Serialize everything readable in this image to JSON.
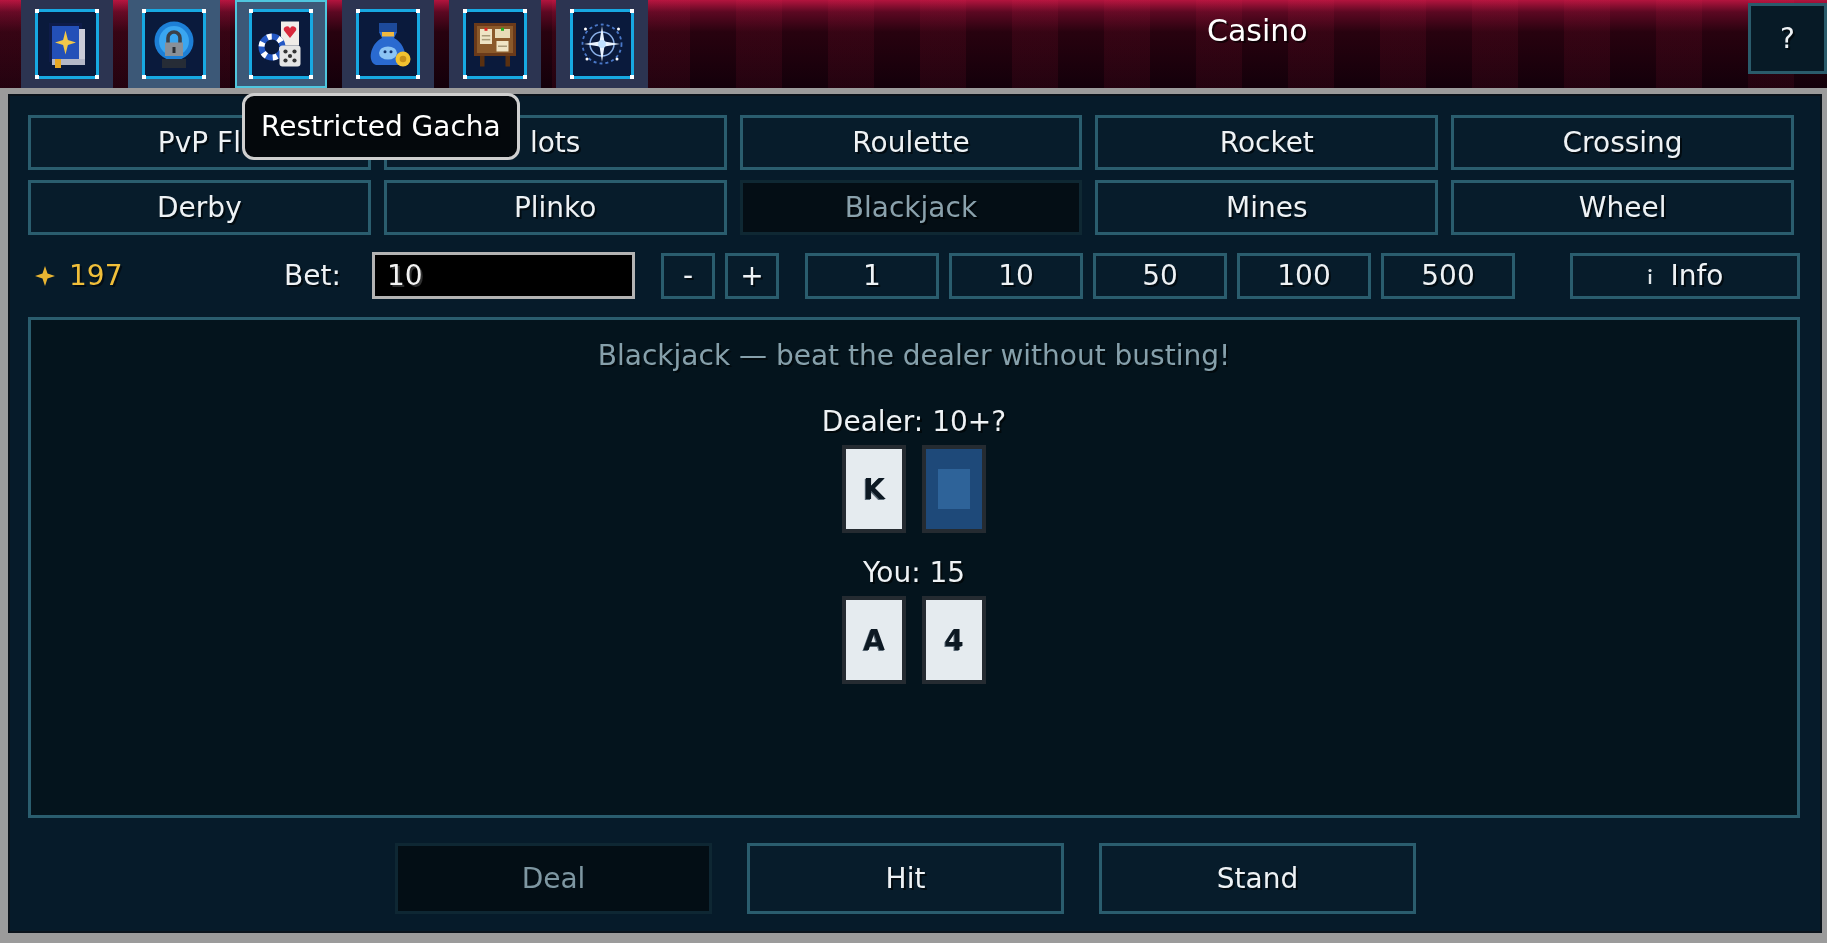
{
  "nav_icons": [
    {
      "kind": "book",
      "selected": false,
      "hovered": false
    },
    {
      "kind": "lock_orb",
      "selected": false,
      "hovered": true
    },
    {
      "kind": "casino",
      "selected": true,
      "hovered": false
    },
    {
      "kind": "money_bag",
      "selected": false,
      "hovered": false
    },
    {
      "kind": "notice_board",
      "selected": false,
      "hovered": false
    },
    {
      "kind": "sparkle_orbit",
      "selected": false,
      "hovered": false
    }
  ],
  "title": "Casino",
  "help_button": "?",
  "tooltip": "Restricted Gacha",
  "game_tabs": [
    {
      "label": "PvP Fl",
      "selected": false
    },
    {
      "label": "lots",
      "selected": false
    },
    {
      "label": "Roulette",
      "selected": false
    },
    {
      "label": "Rocket",
      "selected": false
    },
    {
      "label": "Crossing",
      "selected": false
    },
    {
      "label": "Derby",
      "selected": false
    },
    {
      "label": "Plinko",
      "selected": false
    },
    {
      "label": "Blackjack",
      "selected": true
    },
    {
      "label": "Mines",
      "selected": false
    },
    {
      "label": "Wheel",
      "selected": false
    }
  ],
  "balance": "197",
  "bet": {
    "label": "Bet:",
    "value": "10"
  },
  "bet_steps": [
    "-",
    "+"
  ],
  "bet_amounts": [
    "1",
    "10",
    "50",
    "100",
    "500"
  ],
  "info_button": "Info",
  "table": {
    "caption": "Blackjack — beat the dealer without busting!",
    "hands": [
      {
        "label": "Dealer: 10+?",
        "cards": [
          {
            "rank": "K",
            "face_up": true
          },
          {
            "face_up": false
          }
        ]
      },
      {
        "label": "You: 15",
        "cards": [
          {
            "rank": "A",
            "face_up": true
          },
          {
            "rank": "4",
            "face_up": true
          }
        ]
      }
    ]
  },
  "actions": [
    {
      "label": "Deal",
      "disabled": true
    },
    {
      "label": "Hit",
      "disabled": false
    },
    {
      "label": "Stand",
      "disabled": false
    }
  ]
}
